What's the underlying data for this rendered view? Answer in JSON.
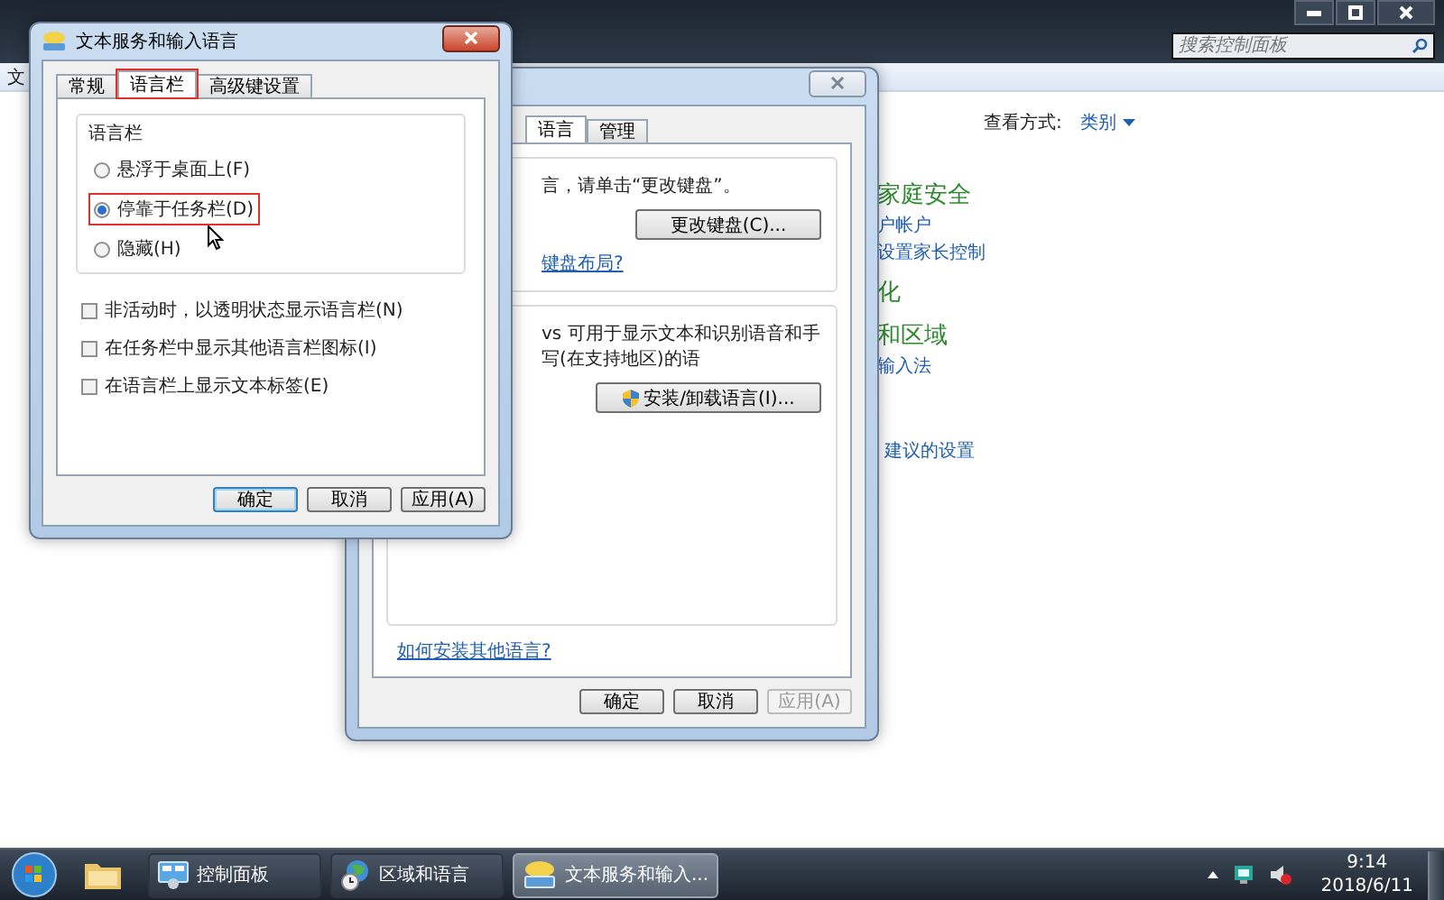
{
  "control_panel": {
    "toolbar_text": "文",
    "search": {
      "placeholder": "搜索控制面板"
    },
    "view_by": {
      "label": "查看方式:",
      "value": "类别"
    },
    "categories": [
      {
        "title": "家庭安全",
        "links": [
          "户帐户",
          "设置家长控制"
        ]
      },
      {
        "title": "化"
      },
      {
        "title": "和区域",
        "links": [
          "输入法"
        ]
      }
    ],
    "extra_link": "建议的设置"
  },
  "region_dialog": {
    "tabs": [
      {
        "label": "语言",
        "selected": true
      },
      {
        "label": "管理",
        "selected": false
      }
    ],
    "keyboard_text": "言，请单击“更改键盘”。",
    "change_keyboard_button": "更改键盘(C)...",
    "keyboard_link": "键盘布局?",
    "display_text": "vs 可用于显示文本和识别语音和手写(在支持地区)的语",
    "install_button": "安装/卸载语言(I)...",
    "help_link": "如何安装其他语言?",
    "buttons": [
      {
        "label": "确定",
        "disabled": false
      },
      {
        "label": "取消",
        "disabled": false
      },
      {
        "label": "应用(A)",
        "disabled": true
      }
    ]
  },
  "text_services_dialog": {
    "title": "文本服务和输入语言",
    "tabs": [
      {
        "label": "常规",
        "selected": false,
        "highlighted": false
      },
      {
        "label": "语言栏",
        "selected": true,
        "highlighted": true
      },
      {
        "label": "高级键设置",
        "selected": false,
        "highlighted": false
      }
    ],
    "group_title": "语言栏",
    "options": [
      {
        "label": "悬浮于桌面上(F)",
        "selected": false,
        "highlighted": false
      },
      {
        "label": "停靠于任务栏(D)",
        "selected": true,
        "highlighted": true
      },
      {
        "label": "隐藏(H)",
        "selected": false,
        "highlighted": false
      }
    ],
    "checkboxes": [
      {
        "label": "非活动时，以透明状态显示语言栏(N)",
        "checked": false
      },
      {
        "label": "在任务栏中显示其他语言栏图标(I)",
        "checked": false
      },
      {
        "label": "在语言栏上显示文本标签(E)",
        "checked": false
      }
    ],
    "buttons": [
      {
        "label": "确定",
        "disabled": false,
        "default": true
      },
      {
        "label": "取消",
        "disabled": false,
        "default": false
      },
      {
        "label": "应用(A)",
        "disabled": false,
        "default": false
      }
    ]
  },
  "taskbar": {
    "tasks": [
      {
        "label": "控制面板",
        "kind": "control-panel",
        "selected": false
      },
      {
        "label": "区域和语言",
        "kind": "globe",
        "selected": false
      },
      {
        "label": "文本服务和输入...",
        "kind": "keyboard",
        "selected": true
      }
    ],
    "clock": {
      "time": "9:14",
      "date": "2018/6/11"
    }
  }
}
